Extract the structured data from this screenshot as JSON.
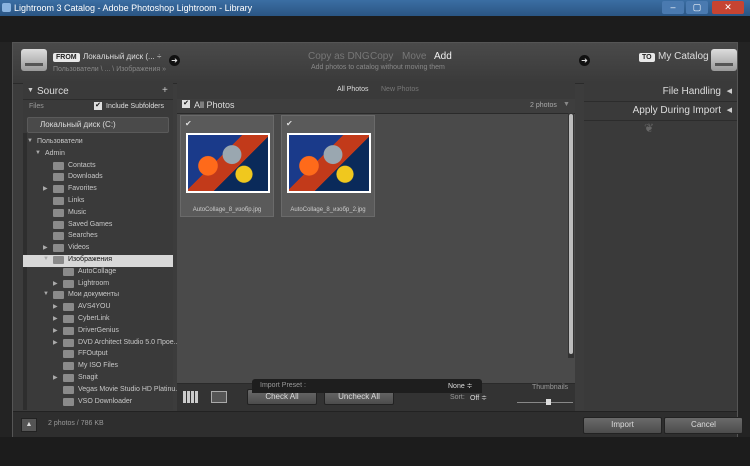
{
  "window": {
    "title": "Lightroom 3 Catalog - Adobe Photoshop Lightroom - Library",
    "min": "–",
    "max": "▢",
    "close": "✕"
  },
  "header": {
    "from_badge": "FROM",
    "from_source": "Локальный диск (...",
    "from_plus": "÷",
    "from_path": "Пользователи \\ ... \\ Изображения »",
    "modes": [
      "Copy as DNG",
      "Copy",
      "Move",
      "Add"
    ],
    "mode_description": "Add photos to catalog without moving them",
    "to_badge": "TO",
    "to_destination": "My Catalog"
  },
  "source": {
    "title": "Source",
    "add": "+",
    "files_label": "Files",
    "include_subfolders": "Include Subfolders",
    "drive": "Локальный диск (C:)",
    "tree": [
      {
        "label": "Пользователи",
        "indent": 0,
        "toggle": "▼",
        "folder": false
      },
      {
        "label": "Admin",
        "indent": 1,
        "toggle": "▼",
        "folder": false
      },
      {
        "label": "Contacts",
        "indent": 2,
        "toggle": "",
        "folder": true
      },
      {
        "label": "Downloads",
        "indent": 2,
        "toggle": "",
        "folder": true
      },
      {
        "label": "Favorites",
        "indent": 2,
        "toggle": "▶",
        "folder": true
      },
      {
        "label": "Links",
        "indent": 2,
        "toggle": "",
        "folder": true
      },
      {
        "label": "Music",
        "indent": 2,
        "toggle": "",
        "folder": true
      },
      {
        "label": "Saved Games",
        "indent": 2,
        "toggle": "",
        "folder": true
      },
      {
        "label": "Searches",
        "indent": 2,
        "toggle": "",
        "folder": true
      },
      {
        "label": "Videos",
        "indent": 2,
        "toggle": "▶",
        "folder": true
      },
      {
        "label": "Изображения",
        "indent": 2,
        "toggle": "▼",
        "folder": true,
        "selected": true
      },
      {
        "label": "AutoCollage",
        "indent": 3,
        "toggle": "",
        "folder": true
      },
      {
        "label": "Lightroom",
        "indent": 3,
        "toggle": "▶",
        "folder": true
      },
      {
        "label": "Мои документы",
        "indent": 2,
        "toggle": "▼",
        "folder": true
      },
      {
        "label": "AVS4YOU",
        "indent": 3,
        "toggle": "▶",
        "folder": true
      },
      {
        "label": "CyberLink",
        "indent": 3,
        "toggle": "▶",
        "folder": true
      },
      {
        "label": "DriverGenius",
        "indent": 3,
        "toggle": "▶",
        "folder": true
      },
      {
        "label": "DVD Architect Studio 5.0 Прое...",
        "indent": 3,
        "toggle": "▶",
        "folder": true
      },
      {
        "label": "FFOutput",
        "indent": 3,
        "toggle": "",
        "folder": true
      },
      {
        "label": "My ISO Files",
        "indent": 3,
        "toggle": "",
        "folder": true
      },
      {
        "label": "Snagit",
        "indent": 3,
        "toggle": "▶",
        "folder": true
      },
      {
        "label": "Vegas Movie Studio HD Platinu...",
        "indent": 3,
        "toggle": "",
        "folder": true
      },
      {
        "label": "VSO Downloader",
        "indent": 3,
        "toggle": "",
        "folder": true
      }
    ]
  },
  "grid": {
    "tab_all": "All Photos",
    "tab_new": "New Photos",
    "bar_label": "All Photos",
    "count": "2 photos",
    "photos": [
      {
        "filename": "AutoCollage_8_изобр.jpg"
      },
      {
        "filename": "AutoCollage_8_изобр_2.jpg"
      }
    ],
    "check_all": "Check All",
    "uncheck_all": "Uncheck All",
    "sort_label": "Sort:",
    "sort_value": "Off ≑",
    "thumbnails_label": "Thumbnails",
    "thumbnail_size": 0.55
  },
  "right": {
    "file_handling": "File Handling",
    "apply_during_import": "Apply During Import",
    "ornament": "❦"
  },
  "footer": {
    "status": "2 photos / 786 KB",
    "import": "Import",
    "cancel": "Cancel",
    "preset_label": "Import Preset :",
    "preset_value": "None ≑"
  }
}
